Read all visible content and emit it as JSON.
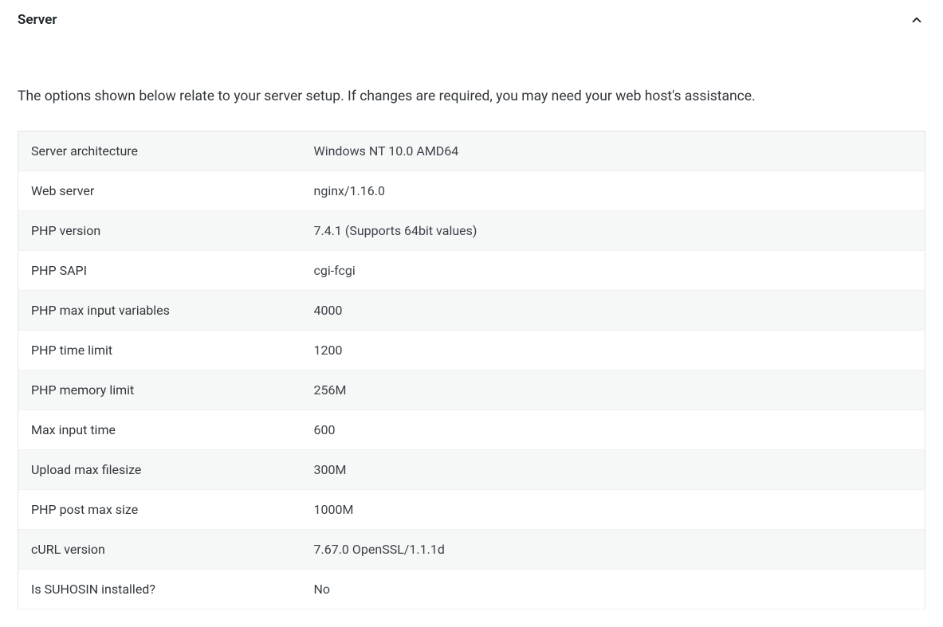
{
  "panel": {
    "title": "Server",
    "description": "The options shown below relate to your server setup. If changes are required, you may need your web host's assistance."
  },
  "rows": [
    {
      "label": "Server architecture",
      "value": "Windows NT 10.0 AMD64"
    },
    {
      "label": "Web server",
      "value": "nginx/1.16.0"
    },
    {
      "label": "PHP version",
      "value": "7.4.1 (Supports 64bit values)"
    },
    {
      "label": "PHP SAPI",
      "value": "cgi-fcgi"
    },
    {
      "label": "PHP max input variables",
      "value": "4000"
    },
    {
      "label": "PHP time limit",
      "value": "1200"
    },
    {
      "label": "PHP memory limit",
      "value": "256M"
    },
    {
      "label": "Max input time",
      "value": "600"
    },
    {
      "label": "Upload max filesize",
      "value": "300M"
    },
    {
      "label": "PHP post max size",
      "value": "1000M"
    },
    {
      "label": "cURL version",
      "value": "7.67.0 OpenSSL/1.1.1d"
    },
    {
      "label": "Is SUHOSIN installed?",
      "value": "No"
    }
  ]
}
